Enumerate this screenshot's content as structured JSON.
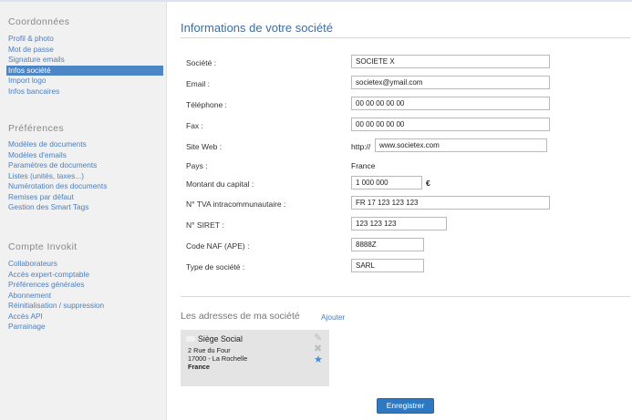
{
  "sidebar": {
    "sections": [
      {
        "title": "Coordonnées",
        "items": [
          "Profil & photo",
          "Mot de passe",
          "Signature emails",
          "Infos société",
          "Import logo",
          "Infos bancaires"
        ]
      },
      {
        "title": "Préférences",
        "items": [
          "Modèles de documents",
          "Modèles d'emails",
          "Paramètres de documents",
          "Listes (unités, taxes...)",
          "Numérotation des documents",
          "Remises par défaut",
          "Gestion des Smart Tags"
        ]
      },
      {
        "title": "Compte Invokit",
        "items": [
          "Collaborateurs",
          "Accès expert-comptable",
          "Préférences générales",
          "Abonnement",
          "Réinitialisation / suppression",
          "Accès API",
          "Parrainage"
        ]
      }
    ],
    "active_item": "Infos société"
  },
  "main": {
    "title": "Informations de votre société",
    "form": {
      "societe": {
        "label": "Société :",
        "value": "SOCIETE X"
      },
      "email": {
        "label": "Email :",
        "value": "societex@ymail.com"
      },
      "telephone": {
        "label": "Téléphone :",
        "value": "00 00 00 00 00"
      },
      "fax": {
        "label": "Fax :",
        "value": "00 00 00 00 00"
      },
      "site_web": {
        "label": "Site Web :",
        "prefix": "http://",
        "value": "www.societex.com"
      },
      "pays": {
        "label": "Pays :",
        "value": "France"
      },
      "capital": {
        "label": "Montant du capital :",
        "value": "1 000 000",
        "currency": "€"
      },
      "tva": {
        "label": "N° TVA intracommunautaire :",
        "value": "FR 17 123 123 123"
      },
      "siret": {
        "label": "N° SIRET :",
        "value": "123 123 123"
      },
      "naf": {
        "label": "Code NAF (APE) :",
        "value": "8888Z"
      },
      "type": {
        "label": "Type de société :",
        "value": "SARL"
      }
    },
    "addresses": {
      "title": "Les adresses de ma société",
      "add_label": "Ajouter",
      "card": {
        "name": "Siège Social",
        "line1": "2 Rue du Four",
        "line2": "17000 - La Rochelle",
        "country": "France",
        "icons": [
          "pencil-icon",
          "close-icon",
          "star-icon"
        ]
      }
    },
    "save_label": "Enregistrer"
  },
  "colors": {
    "accent": "#3a6ea5",
    "link": "#4a7fbf",
    "active_bg": "#4c86c6",
    "button": "#2e78c2",
    "star": "#3d8fe0"
  }
}
